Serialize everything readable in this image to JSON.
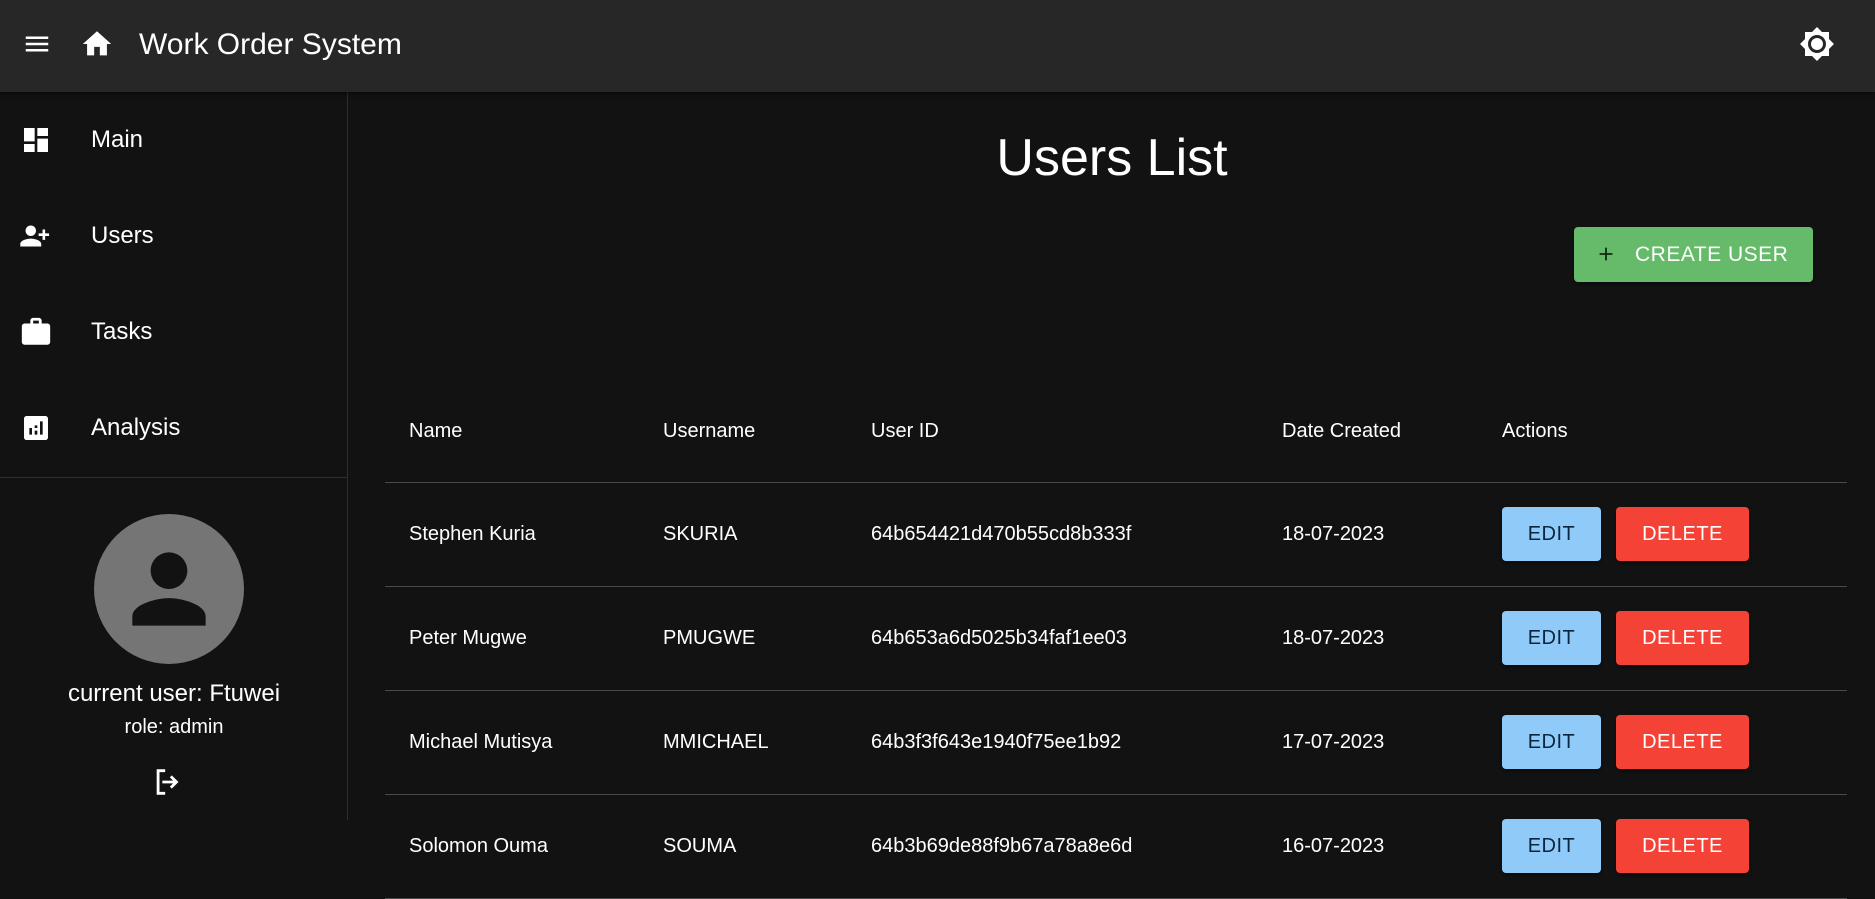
{
  "appbar": {
    "title": "Work Order System",
    "menu_icon": "menu-icon",
    "home_icon": "home-icon",
    "theme_icon": "brightness-icon"
  },
  "sidebar": {
    "items": [
      {
        "label": "Main",
        "icon": "dashboard-icon"
      },
      {
        "label": "Users",
        "icon": "person-add-icon"
      },
      {
        "label": "Tasks",
        "icon": "briefcase-icon"
      },
      {
        "label": "Analysis",
        "icon": "analytics-icon"
      }
    ],
    "current_user": "current user: Ftuwei",
    "role": "role: admin",
    "logout_icon": "logout-icon"
  },
  "main": {
    "title": "Users List",
    "create_button": "CREATE USER",
    "columns": [
      "Name",
      "Username",
      "User ID",
      "Date Created",
      "Actions"
    ],
    "rows": [
      {
        "name": "Stephen Kuria",
        "username": "SKURIA",
        "user_id": "64b654421d470b55cd8b333f",
        "date_created": "18-07-2023"
      },
      {
        "name": "Peter Mugwe",
        "username": "PMUGWE",
        "user_id": "64b653a6d5025b34faf1ee03",
        "date_created": "18-07-2023"
      },
      {
        "name": "Michael Mutisya",
        "username": "MMICHAEL",
        "user_id": "64b3f3f643e1940f75ee1b92",
        "date_created": "17-07-2023"
      },
      {
        "name": "Solomon Ouma",
        "username": "SOUMA",
        "user_id": "64b3b69de88f9b67a78a8e6d",
        "date_created": "16-07-2023"
      }
    ],
    "edit_label": "EDIT",
    "delete_label": "DELETE"
  },
  "colors": {
    "appbar_bg": "#272727",
    "page_bg": "#121212",
    "create_green": "#66bb6a",
    "edit_blue": "#90caf9",
    "delete_red": "#f44336",
    "avatar_gray": "#757575"
  }
}
